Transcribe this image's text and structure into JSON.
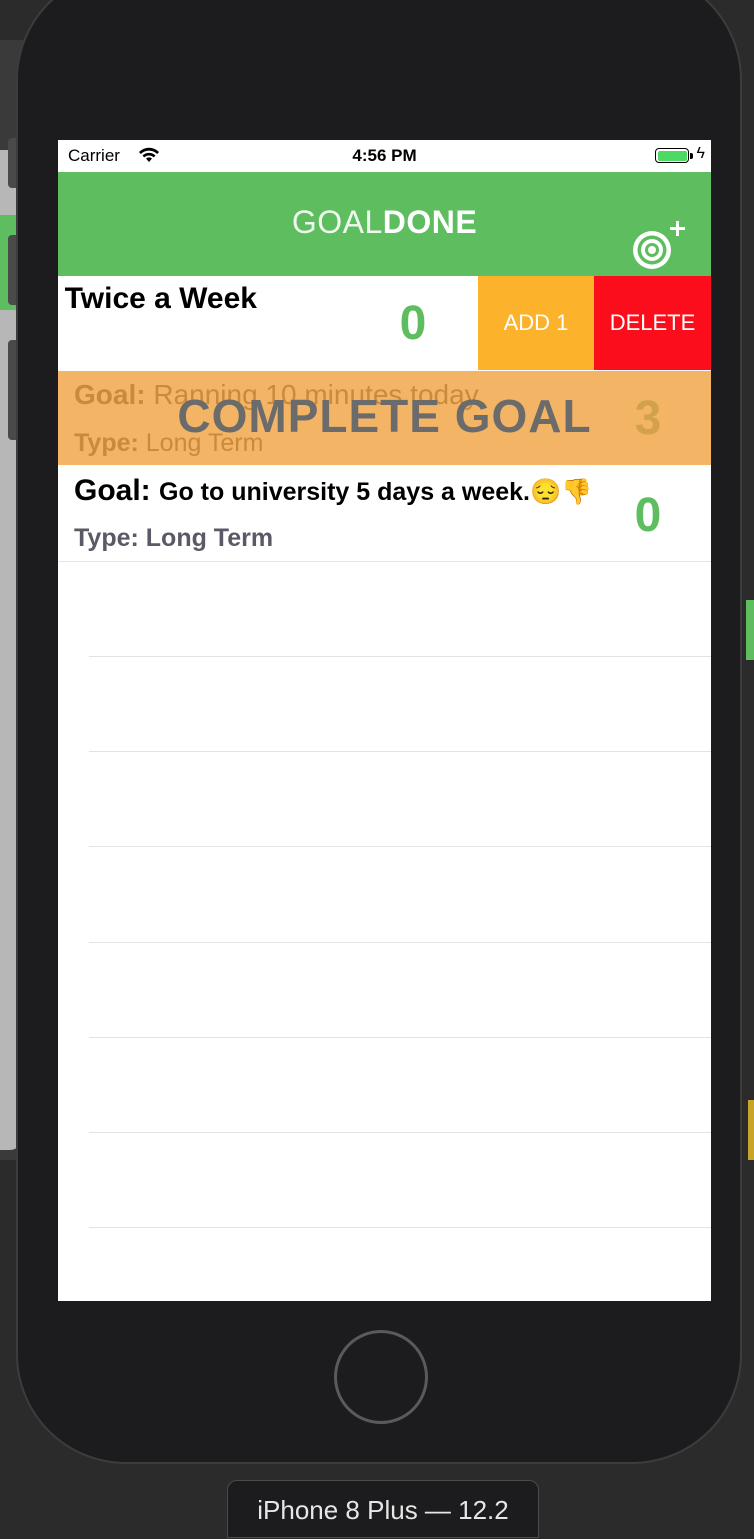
{
  "status_bar": {
    "carrier": "Carrier",
    "time": "4:56 PM",
    "battery_level": 1.0
  },
  "nav": {
    "title_light": "GOAL",
    "title_bold": "DONE",
    "add_icon": "target-plus-icon",
    "color": "#5ebd5f"
  },
  "goals": [
    {
      "title": "l Twice a Week",
      "count": "0",
      "actions": {
        "add_label": "ADD 1",
        "delete_label": "DELETE"
      }
    },
    {
      "goal_label": "Goal:",
      "goal_text": "Ranning 10 minutes today",
      "type_label": "Type:",
      "type_text": "Long Term",
      "count": "3",
      "overlay": "COMPLETE GOAL"
    },
    {
      "goal_label": "Goal:",
      "goal_text": "Go to university 5 days a week.😔👎",
      "type_label": "Type:",
      "type_text": "Long Term",
      "count": "0"
    }
  ],
  "simulator": {
    "device_label": "iPhone 8 Plus — 12.2"
  },
  "colors": {
    "accent_green": "#5ebd5f",
    "add_orange": "#fdb22b",
    "delete_red": "#fc0d1b",
    "complete_orange": "#f4b466"
  }
}
